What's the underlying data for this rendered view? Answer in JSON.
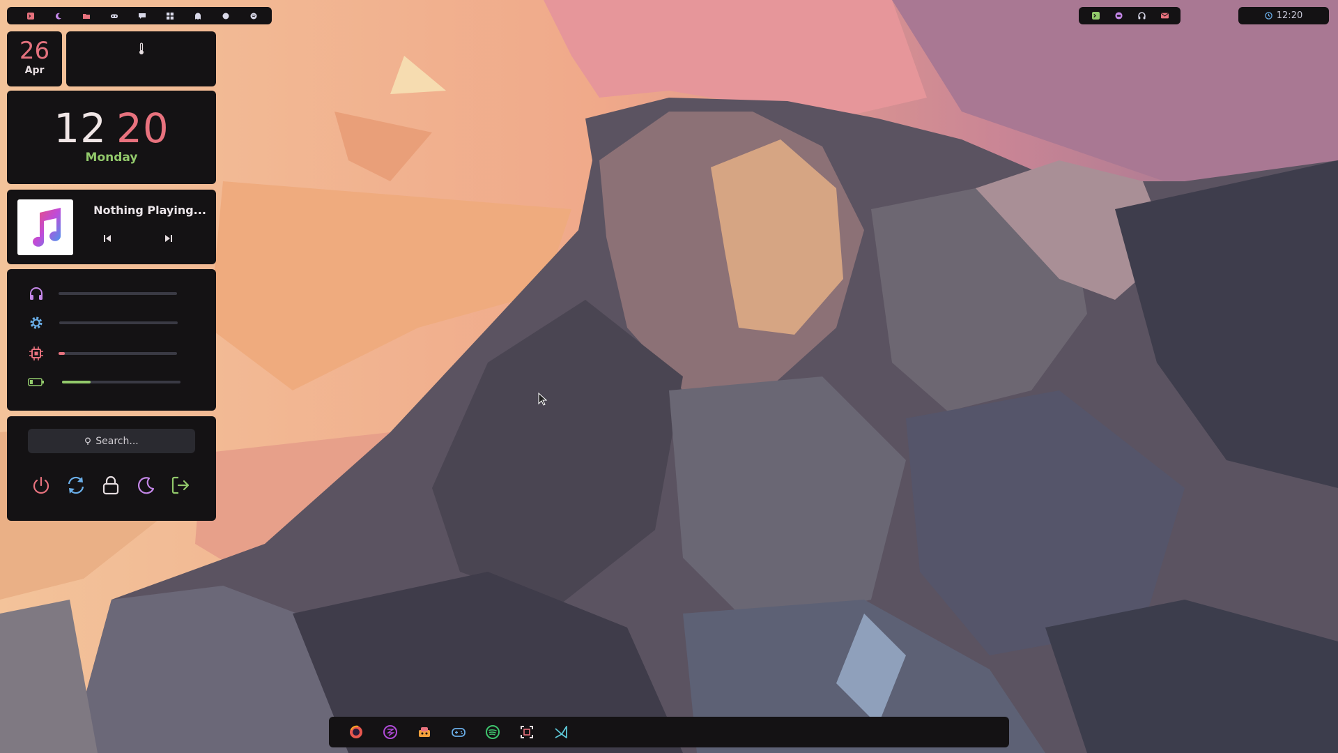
{
  "accent_colors": {
    "pink": "#e8727e",
    "green": "#92c96b",
    "blue": "#6aaee8",
    "purple": "#c487e8",
    "panel_bg": "#141214"
  },
  "workspaces": [
    {
      "icon": "terminal-icon",
      "color": "#e8727e"
    },
    {
      "icon": "moon-icon",
      "color": "#c487e8"
    },
    {
      "icon": "folder-icon",
      "color": "#e8727e"
    },
    {
      "icon": "gamepad-icon",
      "color": "#d8d8e8"
    },
    {
      "icon": "chat-icon",
      "color": "#d8d8e8"
    },
    {
      "icon": "grid-icon",
      "color": "#d8d8e8"
    },
    {
      "icon": "ghost-icon",
      "color": "#d8d8e8"
    },
    {
      "icon": "dot-icon",
      "color": "#d8d8e8"
    },
    {
      "icon": "music-icon",
      "color": "#d8d8e8"
    }
  ],
  "tray": [
    {
      "icon": "terminal-icon",
      "color": "#92c96b"
    },
    {
      "icon": "discord-icon",
      "color": "#c487e8"
    },
    {
      "icon": "headphones-icon",
      "color": "#d8d8e8"
    },
    {
      "icon": "mail-icon",
      "color": "#e8727e"
    }
  ],
  "topbar": {
    "time": "12:20"
  },
  "date": {
    "day": "26",
    "month": "Apr"
  },
  "weather": {
    "icon": "thermometer-icon"
  },
  "clock": {
    "hour": "12",
    "minute": "20",
    "weekday": "Monday"
  },
  "music": {
    "title": "Nothing Playing...",
    "prev_icon": "skip-back-icon",
    "next_icon": "skip-forward-icon"
  },
  "sliders": [
    {
      "name": "volume",
      "icon": "headphones-icon",
      "color": "#c487e8",
      "value": 0.0
    },
    {
      "name": "brightness",
      "icon": "gear-icon",
      "color": "#6aaee8",
      "value": 0.0
    },
    {
      "name": "cpu",
      "icon": "cpu-icon",
      "color": "#e8727e",
      "value": 0.05
    },
    {
      "name": "battery",
      "icon": "battery-icon",
      "color": "#92c96b",
      "value": 0.24
    }
  ],
  "search": {
    "placeholder": "Search..."
  },
  "power_buttons": [
    {
      "name": "power",
      "icon": "power-icon",
      "color": "#e8727e"
    },
    {
      "name": "reboot",
      "icon": "refresh-icon",
      "color": "#6aaee8"
    },
    {
      "name": "lock",
      "icon": "lock-icon",
      "color": "#e6dde0"
    },
    {
      "name": "sleep",
      "icon": "moon-icon",
      "color": "#c487e8"
    },
    {
      "name": "logout",
      "icon": "logout-icon",
      "color": "#92c96b"
    }
  ],
  "dock_apps": [
    {
      "name": "firefox",
      "icon": "firefox-icon"
    },
    {
      "name": "emacs",
      "icon": "emacs-icon"
    },
    {
      "name": "lutris",
      "icon": "lutris-icon"
    },
    {
      "name": "gamepad",
      "icon": "gamepad-icon"
    },
    {
      "name": "spotify",
      "icon": "spotify-icon"
    },
    {
      "name": "screenshot",
      "icon": "screenshot-icon"
    },
    {
      "name": "code-editor",
      "icon": "vscode-icon"
    }
  ]
}
